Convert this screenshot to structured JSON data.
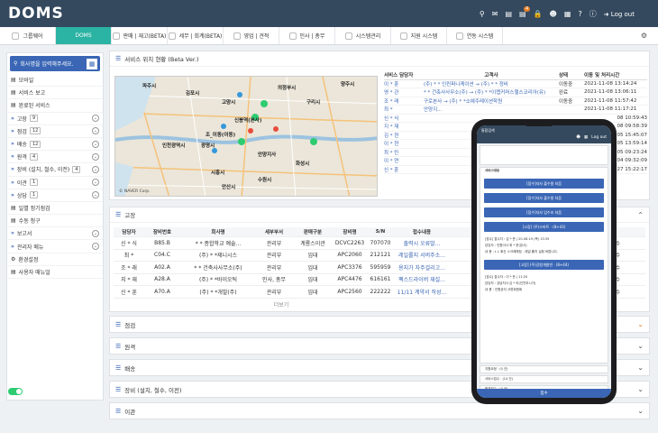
{
  "app": {
    "logo": "DOMS",
    "logout_label": "Log out",
    "notif_count": "4"
  },
  "tabs": [
    {
      "label": "그룹웨어"
    },
    {
      "label": "DOMS"
    },
    {
      "label": "판매 | 재고(BETA)"
    },
    {
      "label": "세무 | 회계(BETA)"
    },
    {
      "label": "영업 | 견적"
    },
    {
      "label": "인사 | 총무"
    },
    {
      "label": "시스템관리"
    },
    {
      "label": "지원 시스템"
    },
    {
      "label": "연동 시스템"
    }
  ],
  "sidebar": {
    "search_placeholder": "회사명을 입력해주세요.",
    "items": [
      {
        "label": "모바일",
        "count": ""
      },
      {
        "label": "서비스 보고",
        "count": ""
      },
      {
        "label": "완료된 서비스",
        "count": ""
      },
      {
        "label": "고장",
        "count": "9"
      },
      {
        "label": "점검",
        "count": "12"
      },
      {
        "label": "배송",
        "count": "12"
      },
      {
        "label": "원격",
        "count": "4"
      },
      {
        "label": "장비 (설치, 철수, 이전)",
        "count": "4"
      },
      {
        "label": "이관",
        "count": "1"
      },
      {
        "label": "상담",
        "count": "1"
      },
      {
        "label": "일별 정기점검",
        "count": ""
      },
      {
        "label": "수동 청구",
        "count": ""
      },
      {
        "label": "보고서",
        "count": ""
      },
      {
        "label": "관리자 메뉴",
        "count": ""
      },
      {
        "label": "환경설정",
        "count": ""
      },
      {
        "label": "사용자 매뉴얼",
        "count": ""
      }
    ]
  },
  "location_panel": {
    "title": "서비스 위치 현황 (Beta Ver.)",
    "map_labels": [
      "김포시",
      "고양시",
      "의정부시",
      "구리시",
      "수원시",
      "시흥시",
      "광명시",
      "안양지사",
      "안산시",
      "화성시",
      "양주시",
      "인천광역시",
      "신봉역(본사)",
      "조_이동(이동)",
      "파주시"
    ],
    "map_footer": "© NAVER Corp.",
    "headers": [
      "서비스 담당자",
      "고객사",
      "상태",
      "이동 및 처리시간"
    ],
    "rows": [
      {
        "agent": "이 * 훈",
        "customer": "(주) * * 인컨퍼니케이션 → (주) * * 정비",
        "status": "이동중",
        "time": "2021-11-08 13:14:24"
      },
      {
        "agent": "영 * 관",
        "customer": "* * 건축사사무소(주) → (주) * *이랩커머스헬스코리아(유)",
        "status": "완료",
        "time": "2021-11-08 13:06:11"
      },
      {
        "agent": "조 * 래",
        "customer": "구로본사 → (주) * *소예주레이션학원",
        "status": "이동중",
        "time": "2021-11-08 11:57:42"
      },
      {
        "agent": "최 *",
        "customer": "안양지...",
        "status": "",
        "time": "2021-11-08 11:17:21"
      },
      {
        "agent": "신 * 식",
        "customer": "",
        "status": "",
        "time": "08 10:59:43"
      },
      {
        "agent": "지 * 재",
        "customer": "",
        "status": "",
        "time": "08 09:58:39"
      },
      {
        "agent": "김 * 현",
        "customer": "",
        "status": "",
        "time": "05 15:45:07"
      },
      {
        "agent": "이 * 현",
        "customer": "",
        "status": "",
        "time": "05 13:59:14"
      },
      {
        "agent": "최 * 민",
        "customer": "",
        "status": "",
        "time": "05 09:23:24"
      },
      {
        "agent": "이 * 연",
        "customer": "",
        "status": "",
        "time": "04 09:32:09"
      },
      {
        "agent": "신 * 훈",
        "customer": "",
        "status": "",
        "time": "27 15:22:17"
      }
    ]
  },
  "breakdown_panel": {
    "title": "고장",
    "headers": [
      "담당자",
      "장비번호",
      "회사명",
      "세부부서",
      "판매구분",
      "장비명",
      "S/N",
      "접수내용"
    ],
    "rows": [
      {
        "agent": "신 * 식",
        "equip_no": "B85.B",
        "company": "* * 종합학교 예술...",
        "dept": "관리부",
        "sale": "계룡스이관",
        "model": "DCVC2263",
        "sn": "707070",
        "desc": "출력시 오류발..."
      },
      {
        "agent": "최 *",
        "equip_no": "C04.C",
        "company": "(주) * *제니시스",
        "dept": "관리부",
        "sale": "임대",
        "model": "APC2060",
        "sn": "212121",
        "desc": "레일롤지 서버주소..."
      },
      {
        "agent": "조 * 래",
        "equip_no": "A02.A",
        "company": "* * 건축사사무소(주)",
        "dept": "관리부",
        "sale": "임대",
        "model": "APC3376",
        "sn": "595959",
        "desc": "용지가 자주걸리고..."
      },
      {
        "agent": "지 * 재",
        "equip_no": "A28.A",
        "company": "(주) * *바이오틱",
        "dept": "인사, 총무",
        "sale": "임대",
        "model": "APC4476",
        "sn": "616161",
        "desc": "팩스드라이버 재설..."
      },
      {
        "agent": "신 * 훈",
        "equip_no": "A70.A",
        "company": "(주) * *개발(주)",
        "dept": "관리부",
        "sale": "임대",
        "model": "APC2560",
        "sn": "222222",
        "desc": "11/11 계약서 작성..."
      }
    ],
    "more_label": "더보기",
    "status_label": "접수"
  },
  "collapsed_panels": [
    {
      "title": "점검"
    },
    {
      "title": "원격"
    },
    {
      "title": "배송"
    },
    {
      "title": "장비 (설치, 철수, 이전)"
    },
    {
      "title": "이관"
    }
  ],
  "phone": {
    "header": "통합검색",
    "logout_label": "Log out",
    "section_title": "서비스대응",
    "buttons": [
      "[접수]자사 출수원 처음",
      "[접수]자사 출수원 처음",
      "[접수]자사 입수조 처음",
      "[고장] (주)스마트 · (8+43)",
      "[고장] (주)강원개발연 · (8+44)"
    ],
    "detail1": [
      "[접수] 접수자 : 김 * 운 | 20-08-19 (목) 15:35",
      "담당자 : 인원이사 최 * 준(본사)",
      "내 용 : L L 회신 스크래예정 - 레일 롤지 실험 바랍니다."
    ],
    "detail2": [
      "[접수] 접수자 : 이 * 운 | 11:20",
      "담당자 : 강남지사 김 * 라(인천부시가)",
      "내 용 : 인원공지 서류위원회"
    ],
    "footer_items": [
      "지원요청 · (0 건)",
      "서비스접수 · (14 건)",
      "원격접수 · (0 건)"
    ],
    "submit_label": "접수"
  }
}
